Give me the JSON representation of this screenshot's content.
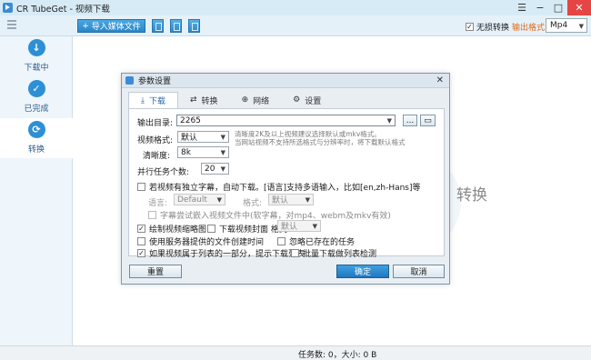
{
  "window": {
    "app_name": "CR TubeGet",
    "separator": " - ",
    "subtitle": "视频下载"
  },
  "toolbar": {
    "import_label": "导入媒体文件",
    "no_loss_label": "无损转换",
    "no_loss_checked": true,
    "output_format_label": "输出格式:",
    "output_format_value": "Mp4"
  },
  "sidebar": {
    "items": [
      {
        "label": "下载中",
        "icon": "download-icon"
      },
      {
        "label": "已完成",
        "icon": "check-icon"
      },
      {
        "label": "转换",
        "icon": "convert-icon"
      }
    ]
  },
  "main": {
    "background_label": "转换"
  },
  "status": {
    "text": "任务数: 0，大小: 0 B"
  },
  "dialog": {
    "title": "参数设置",
    "tabs": [
      {
        "label": "下载",
        "icon": "download-icon"
      },
      {
        "label": "转换",
        "icon": "convert-icon"
      },
      {
        "label": "网络",
        "icon": "globe-icon"
      },
      {
        "label": "设置",
        "icon": "gear-icon"
      }
    ],
    "output_dir_label": "输出目录:",
    "output_dir_value": "2265",
    "browse_label": "...",
    "video_format_label": "视频格式:",
    "video_format_value": "默认",
    "format_note_1": "清晰度2K及以上视频建议选择默认或mkv格式。",
    "format_note_2": "当网站视频不支持所选格式与分辨率时，将下载默认格式",
    "resolution_label": "清晰度:",
    "resolution_value": "8k",
    "parallel_label": "并行任务个数:",
    "parallel_value": "20",
    "subtitle_cb_label": "若视频有独立字幕，自动下载。[语言]支持多语输入，比如[en,zh-Hans]等",
    "language_label": "语言:",
    "language_value": "Default",
    "sub_format_label": "格式:",
    "sub_format_value": "默认",
    "embed_cb_label": "字幕尝试嵌入视频文件中(软字幕，对mp4、webm及mkv有效)",
    "thumbnail_cb_label": "绘制视频缩略图",
    "cover_cb_label": "下载视频封面 格式:",
    "cover_format_value": "默认",
    "server_time_cb_label": "使用服务器提供的文件创建时间",
    "ignore_existing_cb_label": "忽略已存在的任务",
    "playlist_prompt_cb_label": "如果视频属于列表的一部分，提示下载列表",
    "batch_detect_cb_label": "批量下载做列表检测",
    "reset_label": "重置",
    "ok_label": "确定",
    "cancel_label": "取消"
  }
}
